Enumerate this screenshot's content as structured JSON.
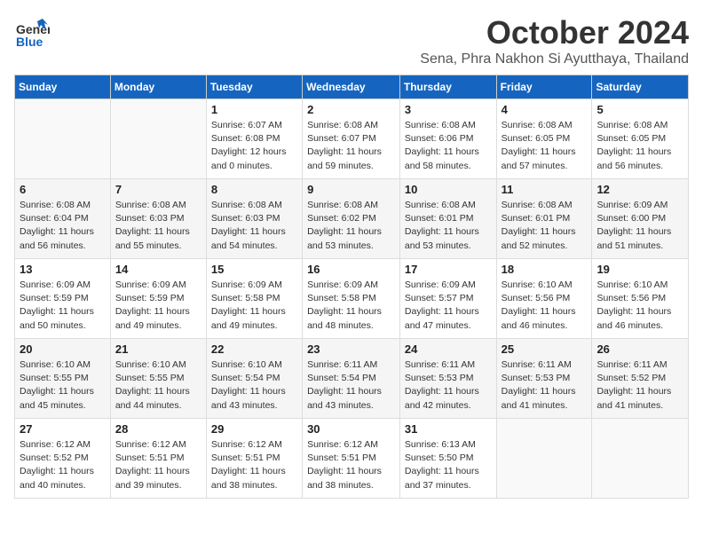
{
  "logo": {
    "general": "General",
    "blue": "Blue"
  },
  "header": {
    "month": "October 2024",
    "location": "Sena, Phra Nakhon Si Ayutthaya, Thailand"
  },
  "weekdays": [
    "Sunday",
    "Monday",
    "Tuesday",
    "Wednesday",
    "Thursday",
    "Friday",
    "Saturday"
  ],
  "weeks": [
    [
      null,
      null,
      {
        "day": "1",
        "sunrise": "6:07 AM",
        "sunset": "6:08 PM",
        "daylight": "12 hours and 0 minutes."
      },
      {
        "day": "2",
        "sunrise": "6:08 AM",
        "sunset": "6:07 PM",
        "daylight": "11 hours and 59 minutes."
      },
      {
        "day": "3",
        "sunrise": "6:08 AM",
        "sunset": "6:06 PM",
        "daylight": "11 hours and 58 minutes."
      },
      {
        "day": "4",
        "sunrise": "6:08 AM",
        "sunset": "6:05 PM",
        "daylight": "11 hours and 57 minutes."
      },
      {
        "day": "5",
        "sunrise": "6:08 AM",
        "sunset": "6:05 PM",
        "daylight": "11 hours and 56 minutes."
      }
    ],
    [
      {
        "day": "6",
        "sunrise": "6:08 AM",
        "sunset": "6:04 PM",
        "daylight": "11 hours and 56 minutes."
      },
      {
        "day": "7",
        "sunrise": "6:08 AM",
        "sunset": "6:03 PM",
        "daylight": "11 hours and 55 minutes."
      },
      {
        "day": "8",
        "sunrise": "6:08 AM",
        "sunset": "6:03 PM",
        "daylight": "11 hours and 54 minutes."
      },
      {
        "day": "9",
        "sunrise": "6:08 AM",
        "sunset": "6:02 PM",
        "daylight": "11 hours and 53 minutes."
      },
      {
        "day": "10",
        "sunrise": "6:08 AM",
        "sunset": "6:01 PM",
        "daylight": "11 hours and 53 minutes."
      },
      {
        "day": "11",
        "sunrise": "6:08 AM",
        "sunset": "6:01 PM",
        "daylight": "11 hours and 52 minutes."
      },
      {
        "day": "12",
        "sunrise": "6:09 AM",
        "sunset": "6:00 PM",
        "daylight": "11 hours and 51 minutes."
      }
    ],
    [
      {
        "day": "13",
        "sunrise": "6:09 AM",
        "sunset": "5:59 PM",
        "daylight": "11 hours and 50 minutes."
      },
      {
        "day": "14",
        "sunrise": "6:09 AM",
        "sunset": "5:59 PM",
        "daylight": "11 hours and 49 minutes."
      },
      {
        "day": "15",
        "sunrise": "6:09 AM",
        "sunset": "5:58 PM",
        "daylight": "11 hours and 49 minutes."
      },
      {
        "day": "16",
        "sunrise": "6:09 AM",
        "sunset": "5:58 PM",
        "daylight": "11 hours and 48 minutes."
      },
      {
        "day": "17",
        "sunrise": "6:09 AM",
        "sunset": "5:57 PM",
        "daylight": "11 hours and 47 minutes."
      },
      {
        "day": "18",
        "sunrise": "6:10 AM",
        "sunset": "5:56 PM",
        "daylight": "11 hours and 46 minutes."
      },
      {
        "day": "19",
        "sunrise": "6:10 AM",
        "sunset": "5:56 PM",
        "daylight": "11 hours and 46 minutes."
      }
    ],
    [
      {
        "day": "20",
        "sunrise": "6:10 AM",
        "sunset": "5:55 PM",
        "daylight": "11 hours and 45 minutes."
      },
      {
        "day": "21",
        "sunrise": "6:10 AM",
        "sunset": "5:55 PM",
        "daylight": "11 hours and 44 minutes."
      },
      {
        "day": "22",
        "sunrise": "6:10 AM",
        "sunset": "5:54 PM",
        "daylight": "11 hours and 43 minutes."
      },
      {
        "day": "23",
        "sunrise": "6:11 AM",
        "sunset": "5:54 PM",
        "daylight": "11 hours and 43 minutes."
      },
      {
        "day": "24",
        "sunrise": "6:11 AM",
        "sunset": "5:53 PM",
        "daylight": "11 hours and 42 minutes."
      },
      {
        "day": "25",
        "sunrise": "6:11 AM",
        "sunset": "5:53 PM",
        "daylight": "11 hours and 41 minutes."
      },
      {
        "day": "26",
        "sunrise": "6:11 AM",
        "sunset": "5:52 PM",
        "daylight": "11 hours and 41 minutes."
      }
    ],
    [
      {
        "day": "27",
        "sunrise": "6:12 AM",
        "sunset": "5:52 PM",
        "daylight": "11 hours and 40 minutes."
      },
      {
        "day": "28",
        "sunrise": "6:12 AM",
        "sunset": "5:51 PM",
        "daylight": "11 hours and 39 minutes."
      },
      {
        "day": "29",
        "sunrise": "6:12 AM",
        "sunset": "5:51 PM",
        "daylight": "11 hours and 38 minutes."
      },
      {
        "day": "30",
        "sunrise": "6:12 AM",
        "sunset": "5:51 PM",
        "daylight": "11 hours and 38 minutes."
      },
      {
        "day": "31",
        "sunrise": "6:13 AM",
        "sunset": "5:50 PM",
        "daylight": "11 hours and 37 minutes."
      },
      null,
      null
    ]
  ],
  "labels": {
    "sunrise_prefix": "Sunrise: ",
    "sunset_prefix": "Sunset: ",
    "daylight_prefix": "Daylight: "
  }
}
